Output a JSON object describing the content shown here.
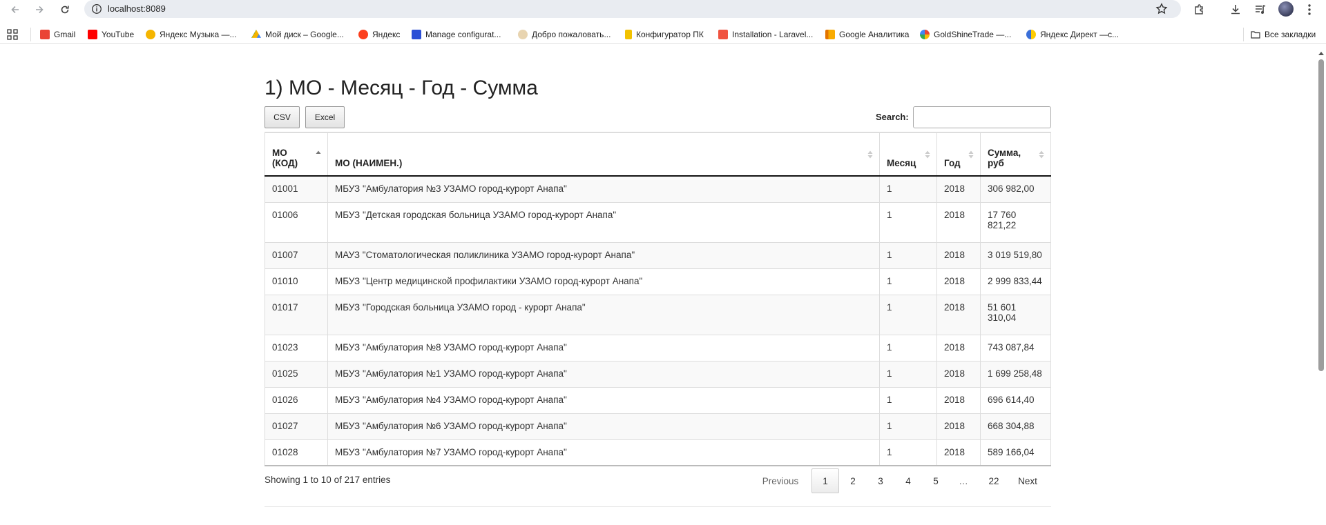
{
  "browser": {
    "url": "localhost:8089",
    "bookmarks": [
      {
        "label": "Gmail",
        "color": "#ea4335"
      },
      {
        "label": "YouTube",
        "color": "#ff0000"
      },
      {
        "label": "Яндекс Музыка —...",
        "color": "#f5b500"
      },
      {
        "label": "Мой диск – Google...",
        "color": "#1a73e8"
      },
      {
        "label": "Яндекс",
        "color": "#fc3f1d"
      },
      {
        "label": "Manage configurat...",
        "color": "#2b4fd6"
      },
      {
        "label": "Добро пожаловать...",
        "color": "#c9a46a"
      },
      {
        "label": "Конфигуратор ПК",
        "color": "#f2c200"
      },
      {
        "label": "Installation - Laravel...",
        "color": "#f05340"
      },
      {
        "label": "Google Аналитика",
        "color": "#f9ab00"
      },
      {
        "label": "GoldShineTrade —...",
        "color": "#3b82f6"
      },
      {
        "label": "Яндекс Директ —с...",
        "color": "#ffcc00"
      }
    ],
    "all_bookmarks": "Все закладки"
  },
  "page": {
    "title": "1) МО - Месяц - Год - Сумма",
    "buttons": {
      "csv": "CSV",
      "excel": "Excel"
    },
    "search_label": "Search:",
    "search_value": ""
  },
  "table": {
    "columns": [
      "МО (КОД)",
      "МО (НАИМЕН.)",
      "Месяц",
      "Год",
      "Сумма, руб"
    ],
    "rows": [
      [
        "01001",
        "МБУЗ \"Амбулатория №3 УЗАМО город-курорт Анапа\"",
        "1",
        "2018",
        "306 982,00"
      ],
      [
        "01006",
        "МБУЗ \"Детская городская больница УЗАМО город-курорт Анапа\"",
        "1",
        "2018",
        "17 760 821,22"
      ],
      [
        "01007",
        "МАУЗ \"Стоматологическая поликлиника УЗАМО город-курорт Анапа\"",
        "1",
        "2018",
        "3 019 519,80"
      ],
      [
        "01010",
        "МБУЗ \"Центр медицинской профилактики УЗАМО город-курорт Анапа\"",
        "1",
        "2018",
        "2 999 833,44"
      ],
      [
        "01017",
        "МБУЗ \"Городская больница УЗАМО город - курорт Анапа\"",
        "1",
        "2018",
        "51 601 310,04"
      ],
      [
        "01023",
        "МБУЗ \"Амбулатория №8 УЗАМО город-курорт Анапа\"",
        "1",
        "2018",
        "743 087,84"
      ],
      [
        "01025",
        "МБУЗ \"Амбулатория №1 УЗАМО город-курорт Анапа\"",
        "1",
        "2018",
        "1 699 258,48"
      ],
      [
        "01026",
        "МБУЗ \"Амбулатория №4 УЗАМО город-курорт Анапа\"",
        "1",
        "2018",
        "696 614,40"
      ],
      [
        "01027",
        "МБУЗ \"Амбулатория №6 УЗАМО город-курорт Анапа\"",
        "1",
        "2018",
        "668 304,88"
      ],
      [
        "01028",
        "МБУЗ \"Амбулатория №7 УЗАМО город-курорт Анапа\"",
        "1",
        "2018",
        "589 166,04"
      ]
    ]
  },
  "footer": {
    "info": "Showing 1 to 10 of 217 entries",
    "pagination": {
      "previous": "Previous",
      "pages": [
        "1",
        "2",
        "3",
        "4",
        "5",
        "…",
        "22"
      ],
      "current": "1",
      "next": "Next"
    }
  }
}
